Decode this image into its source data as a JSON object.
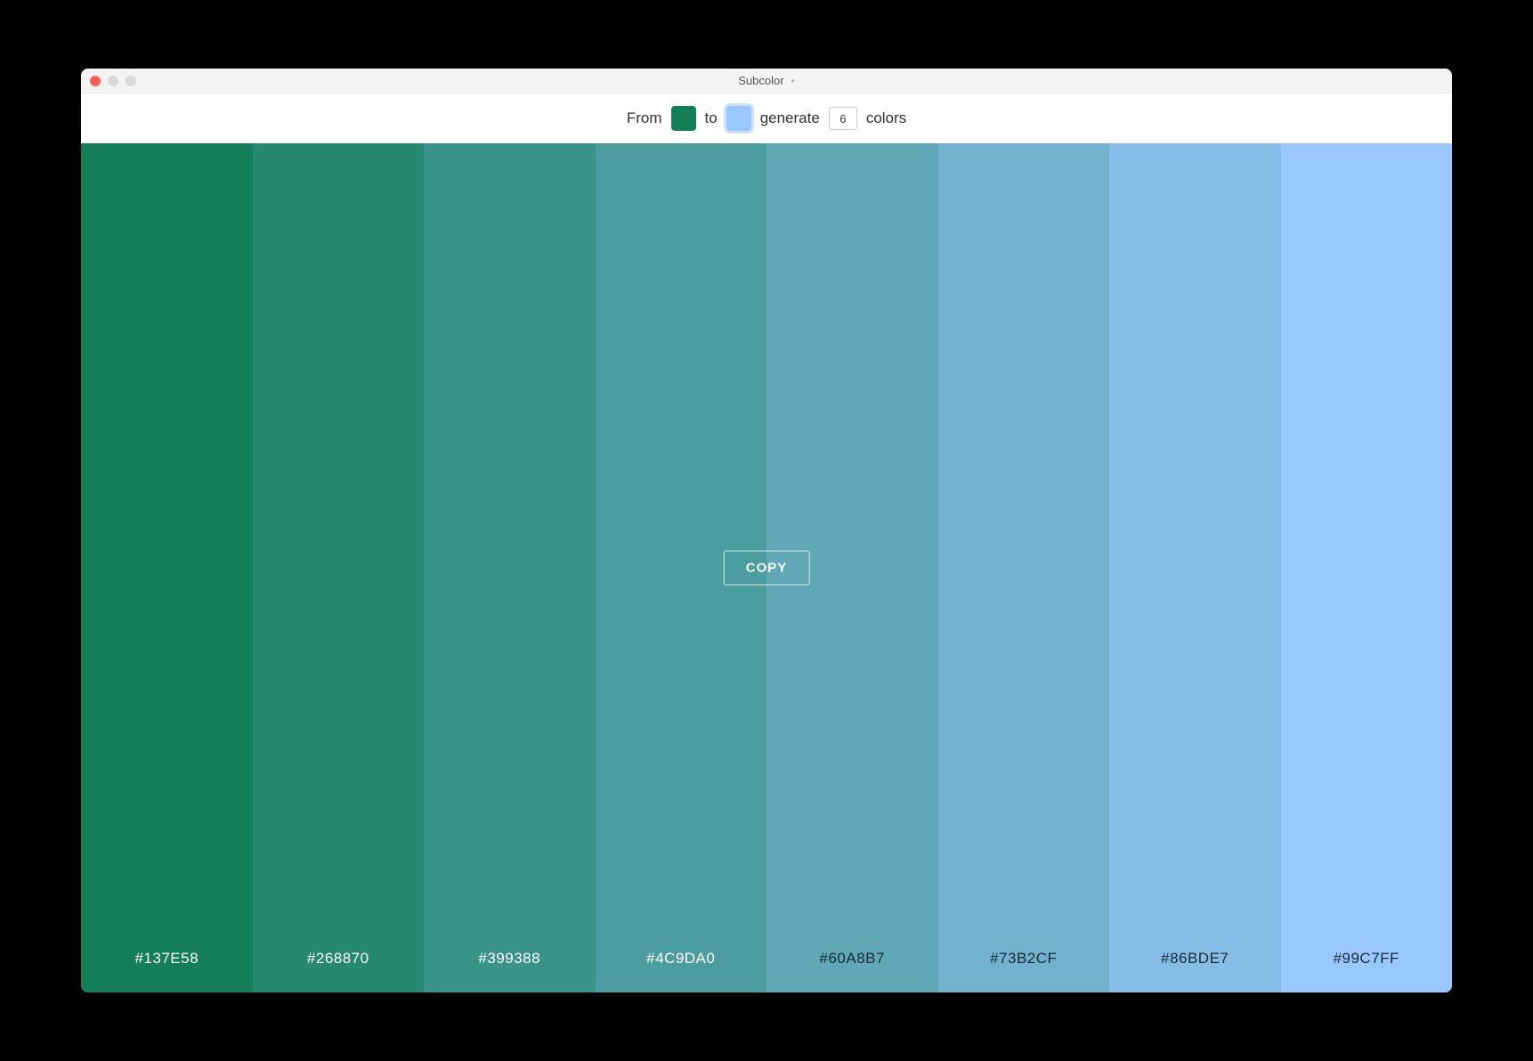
{
  "window": {
    "title": "Subcolor",
    "modified_indicator": "•"
  },
  "toolbar": {
    "from_label": "From",
    "to_label": "to",
    "generate_label": "generate",
    "colors_label": "colors",
    "from_color": "#137E58",
    "to_color": "#99C7FF",
    "count_value": "6"
  },
  "copy_button_label": "COPY",
  "palette": [
    {
      "hex": "#137E58",
      "label_class": "light"
    },
    {
      "hex": "#268870",
      "label_class": "light"
    },
    {
      "hex": "#399388",
      "label_class": "light"
    },
    {
      "hex": "#4C9DA0",
      "label_class": "light"
    },
    {
      "hex": "#60A8B7",
      "label_class": "dark"
    },
    {
      "hex": "#73B2CF",
      "label_class": "dark"
    },
    {
      "hex": "#86BDE7",
      "label_class": "dark"
    },
    {
      "hex": "#99C7FF",
      "label_class": "dark"
    }
  ]
}
